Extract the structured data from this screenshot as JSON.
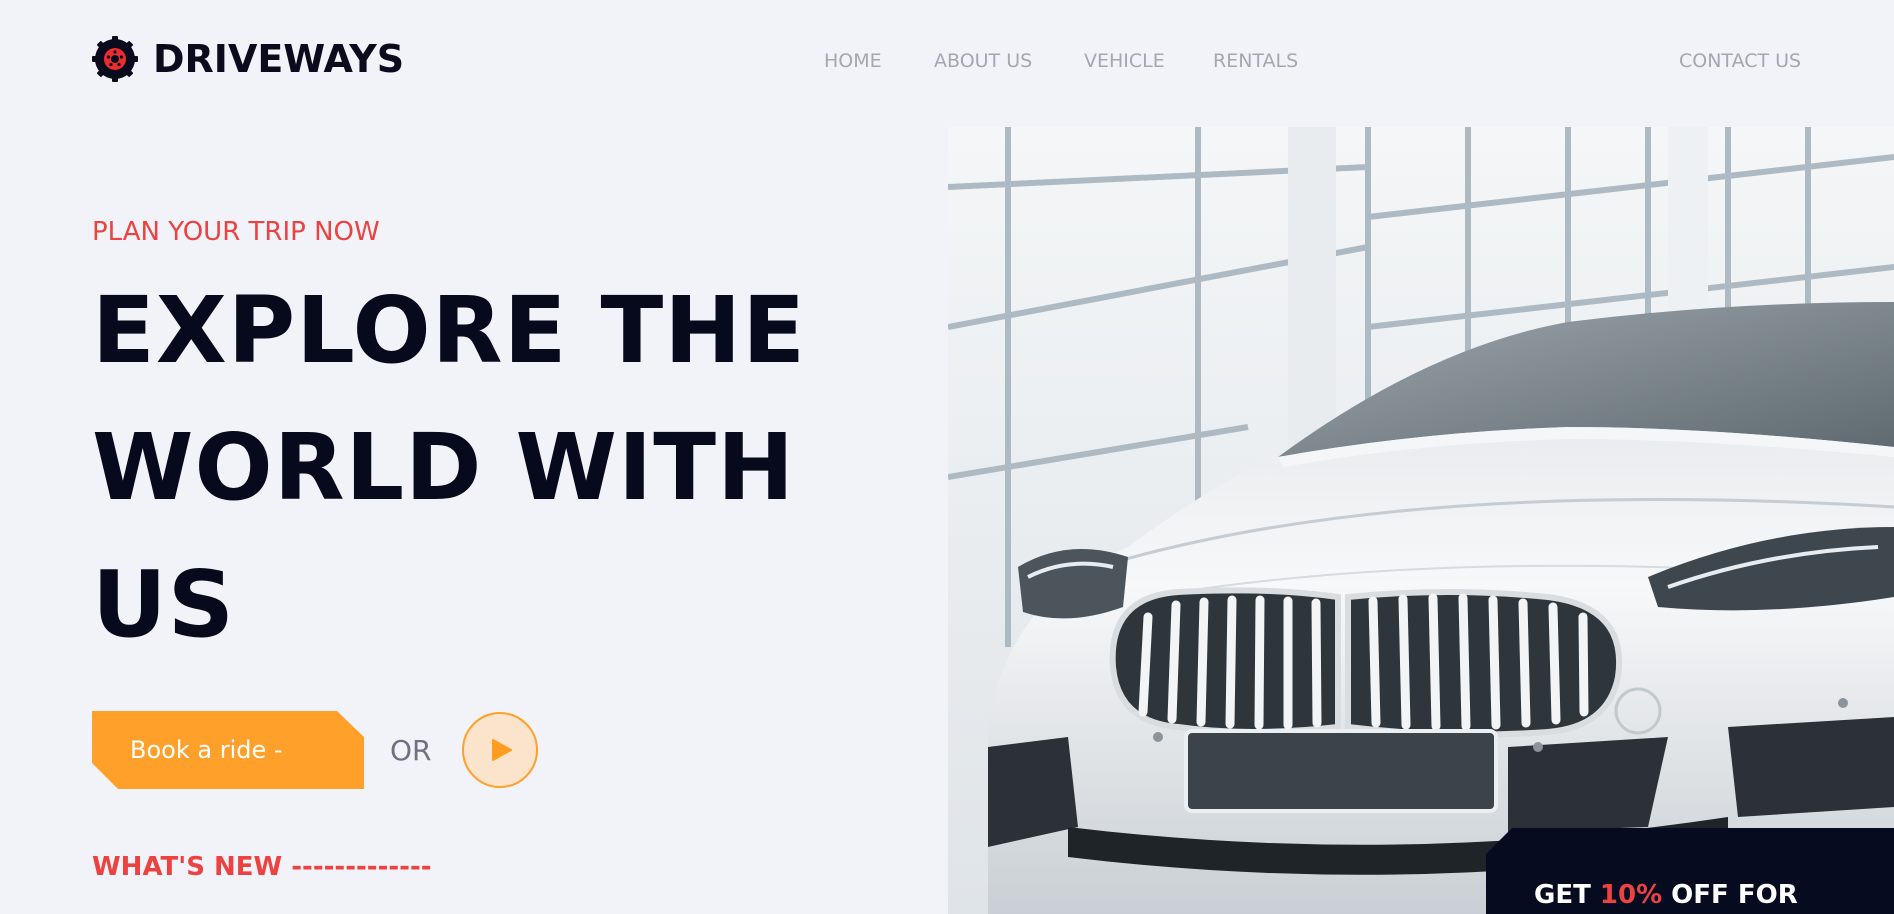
{
  "brand": {
    "name": "DRIVEWAYS",
    "logo_icon": "wheel-icon"
  },
  "nav": {
    "home": "HOME",
    "about": "ABOUT US",
    "vehicle": "VEHICLE",
    "rentals": "RENTALS",
    "contact": "CONTACT US"
  },
  "hero": {
    "eyebrow": "PLAN YOUR TRIP NOW",
    "headline_lines": [
      "EXPLORE THE",
      "WORLD WITH",
      "US"
    ],
    "book_button": "Book a ride -",
    "or_text": "OR",
    "play_icon": "play-icon",
    "whats_new": "WHAT'S NEW -------------"
  },
  "promo": {
    "prefix": "GET ",
    "highlight": "10%",
    "suffix": " OFF FOR"
  },
  "colors": {
    "background": "#f2f3f8",
    "accent_red": "#ec4242",
    "accent_orange": "#ffa02a",
    "dark": "#060a1c",
    "nav_text": "#a3a6b3"
  }
}
